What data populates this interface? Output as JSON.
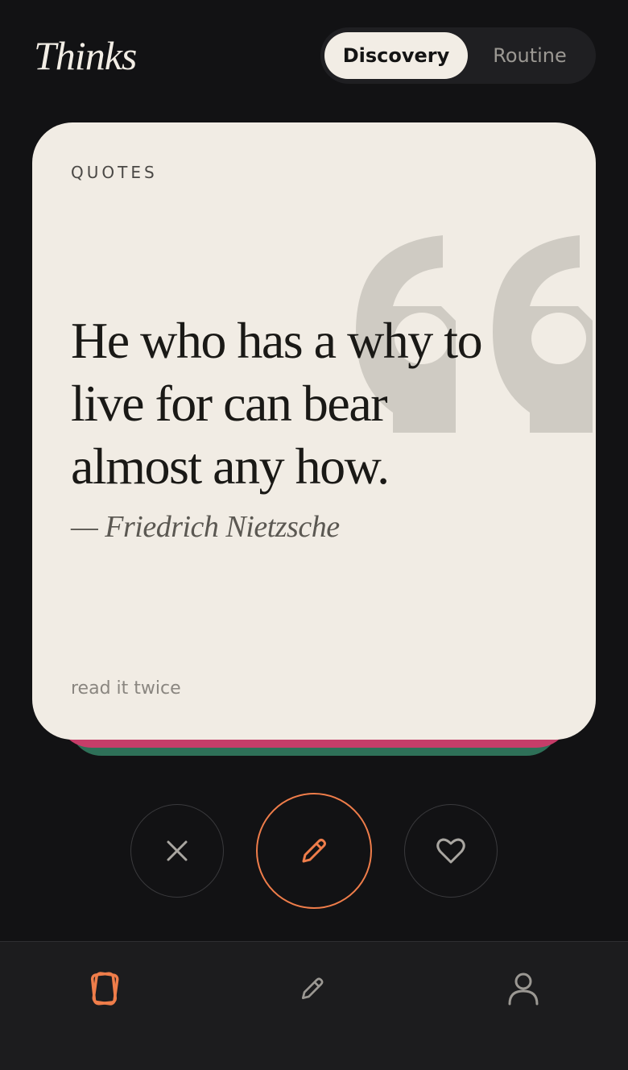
{
  "app": {
    "title": "Thinks"
  },
  "segment": {
    "options": [
      "Discovery",
      "Routine"
    ],
    "active": "Discovery"
  },
  "card": {
    "category": "QUOTES",
    "quote": "He who has a why to live for can bear almost any how.",
    "author": "— Friedrich Nietzsche",
    "note": "read it twice"
  },
  "actions": {
    "dismiss_icon": "close-icon",
    "edit_icon": "pencil-icon",
    "like_icon": "heart-icon"
  },
  "tabbar": {
    "items": [
      {
        "icon": "cards-icon",
        "active": true
      },
      {
        "icon": "pencil-icon",
        "active": false
      },
      {
        "icon": "person-icon",
        "active": false
      }
    ]
  },
  "colors": {
    "accent": "#ef7d4a",
    "background": "#121214",
    "card": "#f1ece4",
    "stack_pink": "#c63d69",
    "stack_green": "#2e7058"
  }
}
